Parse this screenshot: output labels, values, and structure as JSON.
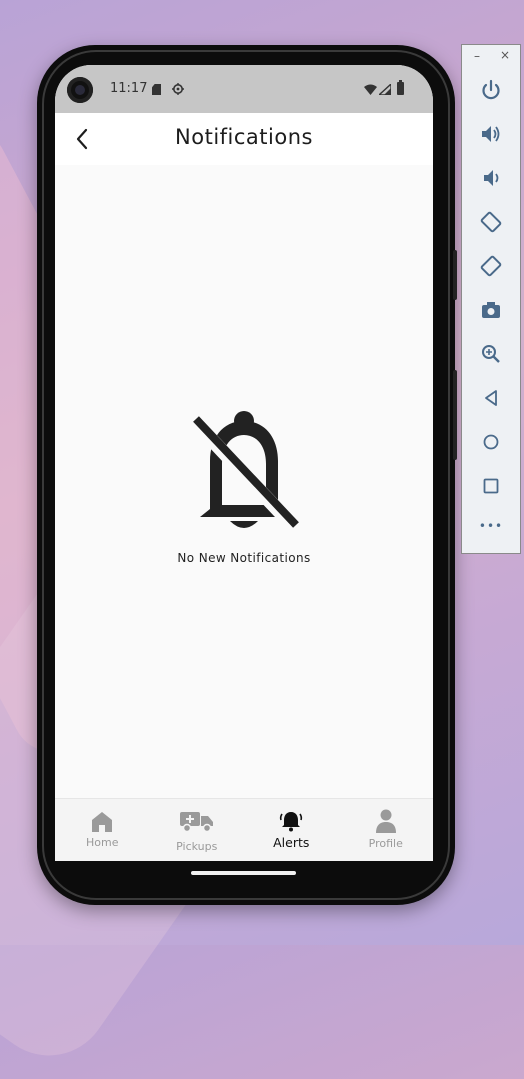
{
  "status_bar": {
    "time": "11:17"
  },
  "app_bar": {
    "title": "Notifications"
  },
  "empty_state": {
    "message": "No New Notifications"
  },
  "bottom_nav": {
    "items": [
      {
        "label": "Home",
        "icon": "home-icon",
        "active": false
      },
      {
        "label": "Pickups",
        "icon": "truck-icon",
        "active": false
      },
      {
        "label": "Alerts",
        "icon": "bell-ringing-icon",
        "active": true
      },
      {
        "label": "Profile",
        "icon": "person-icon",
        "active": false
      }
    ]
  },
  "emulator_toolbar": {
    "minimize": "–",
    "close": "×",
    "more": "•••",
    "buttons": [
      "power-icon",
      "volume-up-icon",
      "volume-down-icon",
      "rotate-left-icon",
      "rotate-right-icon",
      "camera-icon",
      "zoom-icon",
      "back-icon",
      "home-circle-icon",
      "overview-icon",
      "more-icon"
    ]
  },
  "colors": {
    "accent": "#1d1d1d",
    "inactive": "#9a9a9a",
    "statusbar": "#c6c6c6",
    "toolbar_icon": "#4a6a8a"
  }
}
